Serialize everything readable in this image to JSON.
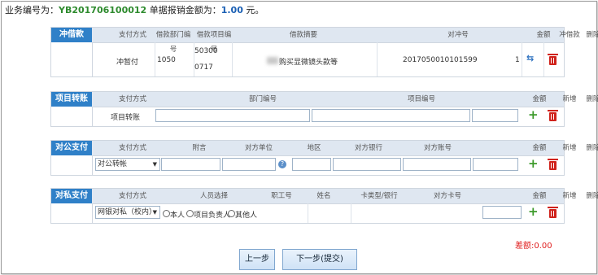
{
  "header": {
    "prefix": "业务编号为：",
    "code": "YB201706100012",
    "mid": "单据报销金额为：",
    "amount": "1.00",
    "suffix": "元。"
  },
  "chongjie": {
    "label": "冲借款",
    "columns": [
      "支付方式",
      "借款部门编号",
      "借款项目编号",
      "借款摘要",
      "对冲号",
      "金额",
      "冲借款",
      "删除"
    ],
    "row": {
      "pay_method": "冲暂付",
      "dept_no": "1050",
      "project_no_line1": "50300",
      "project_no_line2": "0717",
      "summary": "购买显微镜头款等",
      "offset_no": "2017050010101599",
      "amount": "1"
    }
  },
  "xiangmu": {
    "label": "项目转账",
    "columns": [
      "支付方式",
      "部门编号",
      "项目编号",
      "金额",
      "新增",
      "删除"
    ],
    "row": {
      "pay_method": "项目转账"
    }
  },
  "duigong": {
    "label": "对公支付",
    "columns": [
      "支付方式",
      "附言",
      "对方单位",
      "地区",
      "对方银行",
      "对方账号",
      "金额",
      "新增",
      "删除"
    ],
    "row": {
      "pay_method": "对公转帐"
    }
  },
  "dusi": {
    "label": "对私支付",
    "columns": [
      "支付方式",
      "人员选择",
      "职工号",
      "姓名",
      "卡类型/银行",
      "对方卡号",
      "金额",
      "新增",
      "删除"
    ],
    "row": {
      "pay_method": "网银对私（校内）",
      "radio1": "本人",
      "radio2": "项目负责人",
      "radio3": "其他人"
    }
  },
  "difference": "差额:0.00",
  "buttons": {
    "prev": "上一步",
    "next": "下一步(提交)"
  }
}
